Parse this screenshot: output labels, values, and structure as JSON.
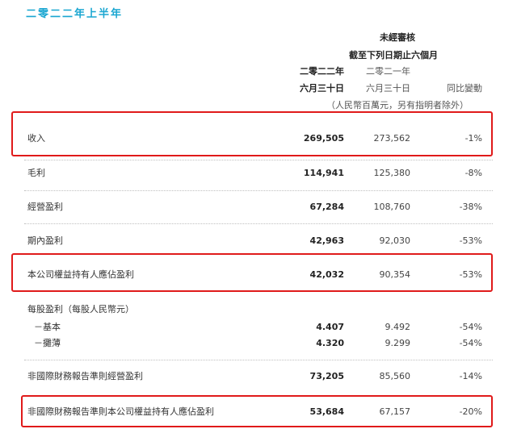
{
  "title": "二零二二年上半年",
  "header": {
    "unaudited": "未經審核",
    "six_months": "截至下列日期止六個月",
    "col1_year": "二零二二年",
    "col2_year": "二零二一年",
    "col1_date": "六月三十日",
    "col2_date": "六月三十日",
    "col3": "同比變動",
    "unit": "（人民幣百萬元，另有指明者除外）"
  },
  "rows": [
    {
      "label": "收入",
      "v2022": "269,505",
      "v2021": "273,562",
      "change": "-1%"
    },
    {
      "label": "毛利",
      "v2022": "114,941",
      "v2021": "125,380",
      "change": "-8%"
    },
    {
      "label": "經營盈利",
      "v2022": "67,284",
      "v2021": "108,760",
      "change": "-38%"
    },
    {
      "label": "期內盈利",
      "v2022": "42,963",
      "v2021": "92,030",
      "change": "-53%"
    },
    {
      "label": "本公司權益持有人應佔盈利",
      "v2022": "42,032",
      "v2021": "90,354",
      "change": "-53%"
    },
    {
      "label": "每股盈利（每股人民幣元）",
      "v2022": "",
      "v2021": "",
      "change": ""
    },
    {
      "label": "－基本",
      "v2022": "4.407",
      "v2021": "9.492",
      "change": "-54%"
    },
    {
      "label": "－攤薄",
      "v2022": "4.320",
      "v2021": "9.299",
      "change": "-54%"
    },
    {
      "label": "非國際財務報告準則經營盈利",
      "v2022": "73,205",
      "v2021": "85,560",
      "change": "-14%"
    },
    {
      "label": "非國際財務報告準則本公司權益持有人應佔盈利",
      "v2022": "53,684",
      "v2021": "67,157",
      "change": "-20%"
    }
  ],
  "colors": {
    "title": "#1aa6d1",
    "highlight": "#e01a1a"
  }
}
